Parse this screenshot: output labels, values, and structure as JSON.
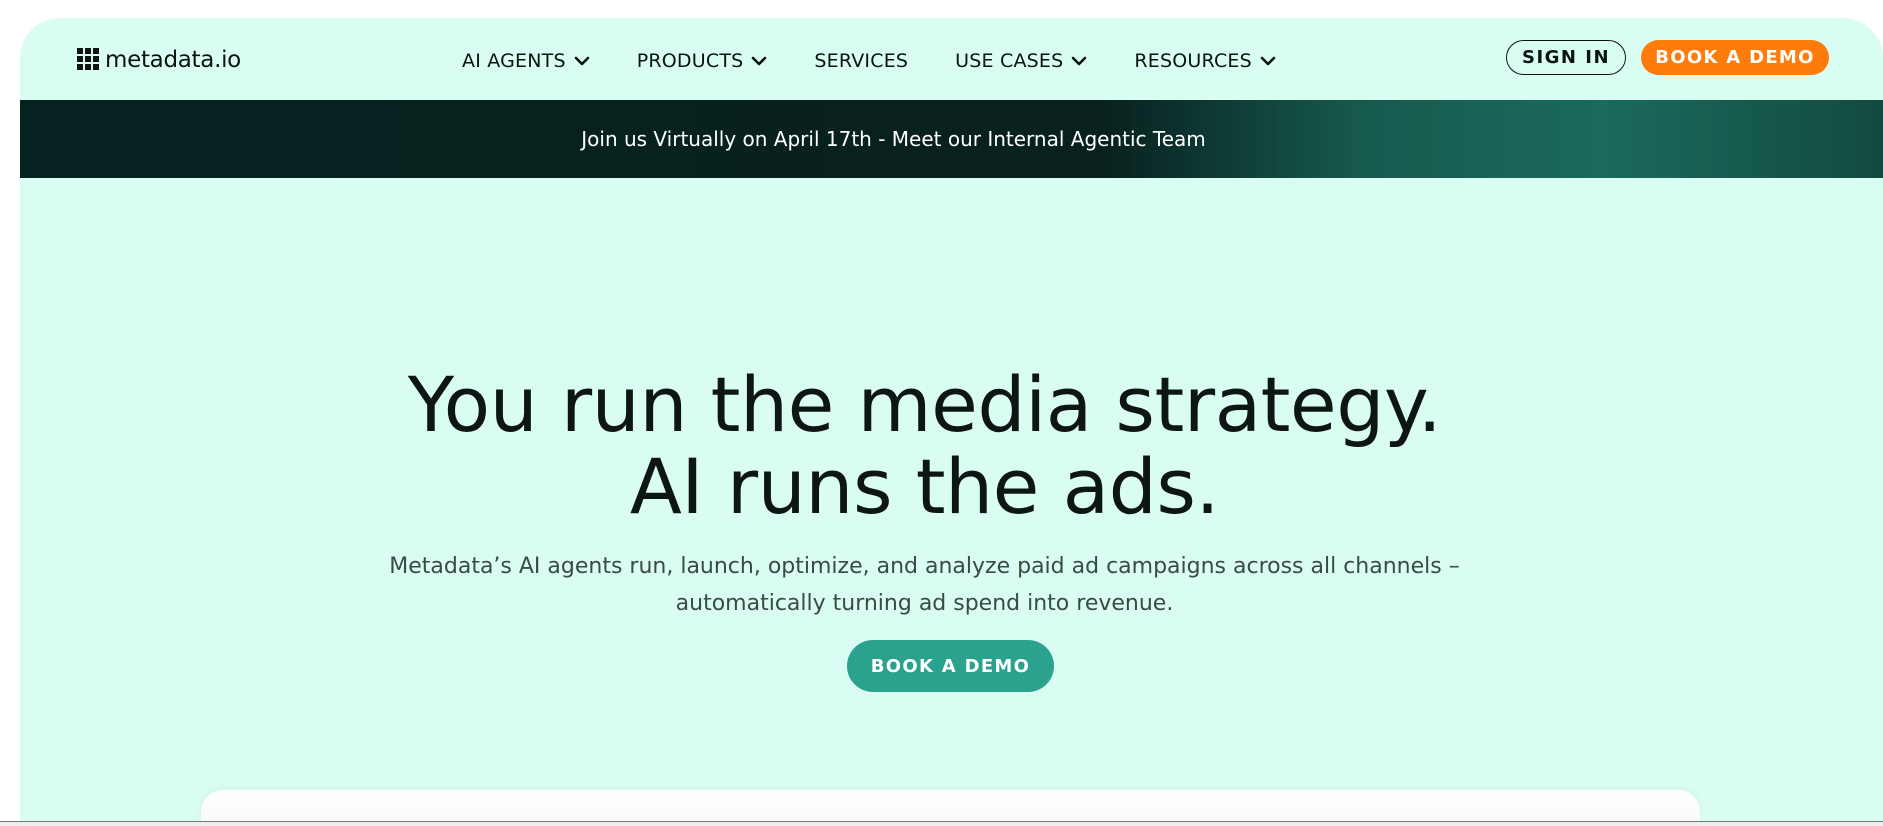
{
  "brand": {
    "logo_text": "metadata.io",
    "logo_icon": "grid-icon"
  },
  "nav": {
    "items": [
      {
        "label": "AI AGENTS",
        "dropdown": true
      },
      {
        "label": "PRODUCTS",
        "dropdown": true
      },
      {
        "label": "SERVICES",
        "dropdown": false
      },
      {
        "label": "USE CASES",
        "dropdown": true
      },
      {
        "label": "RESOURCES",
        "dropdown": true
      }
    ],
    "sign_in_label": "SIGN IN",
    "book_demo_label": "BOOK A DEMO"
  },
  "announcement": {
    "text": "Join us Virtually on April 17th - Meet our Internal Agentic Team"
  },
  "hero": {
    "title_line1": "You run the media strategy.",
    "title_line2": "AI runs the ads.",
    "subtitle_line1": "Metadata’s AI agents run, launch, optimize, and analyze paid ad campaigns across all channels –",
    "subtitle_line2": "automatically turning ad spend into revenue.",
    "cta_label": "BOOK A DEMO"
  },
  "colors": {
    "page_bg": "#d9fdf3",
    "accent_orange": "#ff7c0a",
    "accent_teal": "#2aa28e",
    "banner_dark": "#062220",
    "text_dark": "#0b1412"
  }
}
